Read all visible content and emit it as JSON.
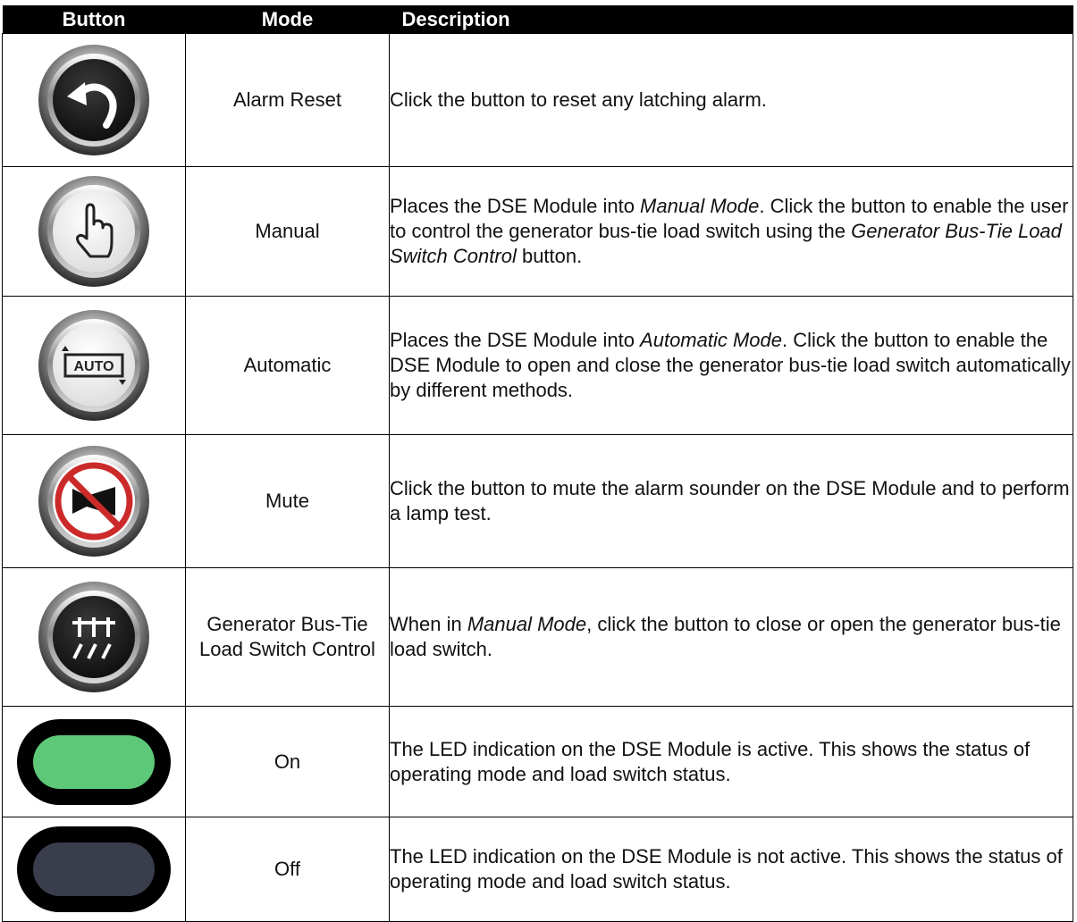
{
  "header": {
    "button": "Button",
    "mode": "Mode",
    "description": "Description"
  },
  "rows": [
    {
      "icon": "alarm-reset-icon",
      "mode": "Alarm Reset",
      "desc": [
        {
          "t": "Click the button to reset any latching alarm.",
          "i": false
        }
      ]
    },
    {
      "icon": "manual-hand-icon",
      "mode": "Manual",
      "desc": [
        {
          "t": "Places the DSE Module into ",
          "i": false
        },
        {
          "t": "Manual Mode",
          "i": true
        },
        {
          "t": ". Click the button to enable the user to control the generator bus-tie load switch using the ",
          "i": false
        },
        {
          "t": "Generator Bus-Tie Load Switch Control",
          "i": true
        },
        {
          "t": " button.",
          "i": false
        }
      ]
    },
    {
      "icon": "auto-mode-icon",
      "icon_text": "AUTO",
      "mode": "Automatic",
      "desc": [
        {
          "t": "Places the DSE Module into ",
          "i": false
        },
        {
          "t": "Automatic Mode",
          "i": true
        },
        {
          "t": ". Click the button to enable the DSE Module to open and close the generator bus-tie load switch automatically by different methods.",
          "i": false
        }
      ]
    },
    {
      "icon": "mute-icon",
      "mode": "Mute",
      "desc": [
        {
          "t": "Click the button to mute the alarm sounder on the DSE Module and to perform a lamp test.",
          "i": false
        }
      ]
    },
    {
      "icon": "bus-tie-switch-icon",
      "mode": "Generator Bus-Tie Load Switch Control",
      "desc": [
        {
          "t": "When in ",
          "i": false
        },
        {
          "t": "Manual Mode",
          "i": true
        },
        {
          "t": ", click the button to close or open the generator bus-tie load switch.",
          "i": false
        }
      ]
    },
    {
      "icon": "led-on-icon",
      "mode": "On",
      "desc": [
        {
          "t": "The LED indication on the DSE Module is active. This shows the status of operating mode and load switch status.",
          "i": false
        }
      ]
    },
    {
      "icon": "led-off-icon",
      "mode": "Off",
      "desc": [
        {
          "t": "The LED indication on the DSE Module is not active. This shows the status of operating mode and load switch status.",
          "i": false
        }
      ]
    }
  ],
  "colors": {
    "header_bg": "#000000",
    "led_on": "#5cc878",
    "led_off": "#3a3d4c",
    "mute_red": "#cc2a2a"
  }
}
